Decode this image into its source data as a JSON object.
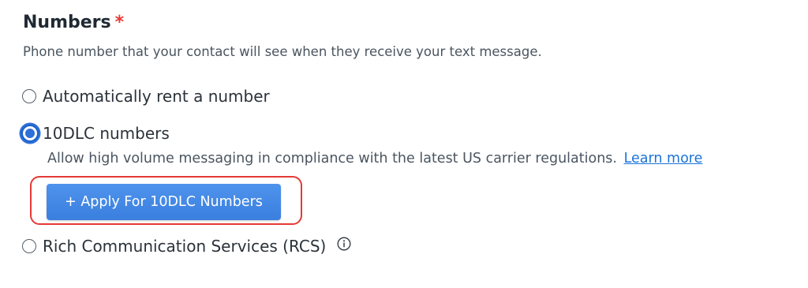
{
  "field": {
    "title": "Numbers",
    "required_marker": "*",
    "description": "Phone number that your contact will see when they receive your text message."
  },
  "options": [
    {
      "label": "Automatically rent a number",
      "selected": false
    },
    {
      "label": "10DLC numbers",
      "selected": true,
      "description": "Allow high volume messaging in compliance with the latest US carrier regulations.",
      "link_text": "Learn more",
      "button_label": "+ Apply For 10DLC Numbers"
    },
    {
      "label": "Rich Communication Services (RCS)",
      "selected": false,
      "icon": "info-icon"
    }
  ],
  "colors": {
    "accent": "#2f6fd8",
    "button": "#4a8ce8",
    "link": "#1a73d9",
    "required": "#e53935",
    "highlight": "#e53935"
  }
}
